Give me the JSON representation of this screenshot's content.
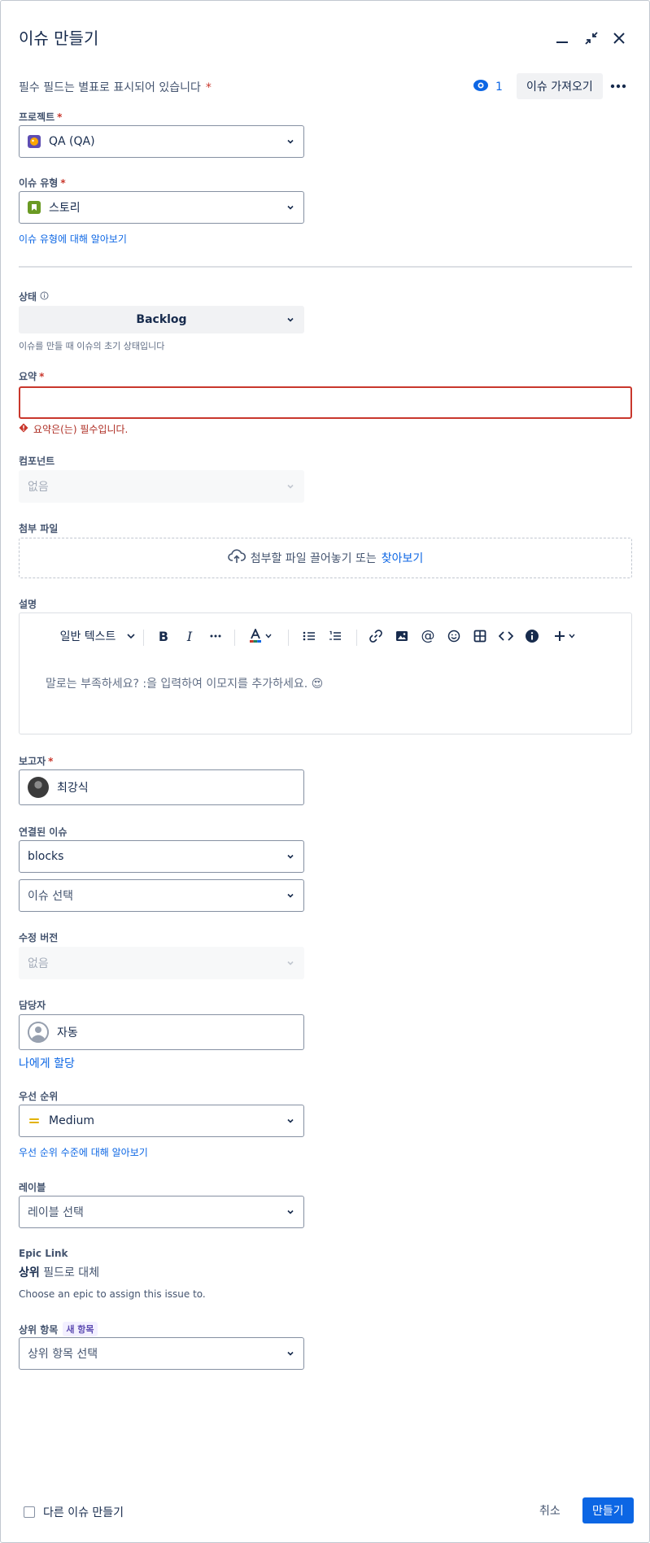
{
  "header": {
    "title": "이슈 만들기",
    "required_note": "필수 필드는 별표로 표시되어 있습니다",
    "required_star": "*",
    "watch_count": "1",
    "import_label": "이슈 가져오기"
  },
  "project": {
    "label": "프로젝트",
    "value": "QA (QA)"
  },
  "issue_type": {
    "label": "이슈 유형",
    "value": "스토리",
    "learn_link": "이슈 유형에 대해 알아보기"
  },
  "status": {
    "label": "상태",
    "value": "Backlog",
    "help": "이슈를 만들 때 이슈의 초기 상태입니다"
  },
  "summary": {
    "label": "요약",
    "value": "",
    "error": "요약은(는) 필수입니다."
  },
  "components": {
    "label": "컴포넌트",
    "value": "없음"
  },
  "attachment": {
    "label": "첨부 파일",
    "drop_text": "첨부할 파일 끌어놓기 또는",
    "browse": "찾아보기"
  },
  "description": {
    "label": "설명",
    "text_style": "일반 텍스트",
    "placeholder": "말로는 부족하세요? :을 입력하여 이모지를 추가하세요. 😍"
  },
  "reporter": {
    "label": "보고자",
    "value": "최강식"
  },
  "linked_issues": {
    "label": "연결된 이슈",
    "link_type": "blocks",
    "issue_placeholder": "이슈 선택"
  },
  "fix_version": {
    "label": "수정 버전",
    "value": "없음"
  },
  "assignee": {
    "label": "담당자",
    "value": "자동",
    "assign_me": "나에게 할당"
  },
  "priority": {
    "label": "우선 순위",
    "value": "Medium",
    "learn_link": "우선 순위 수준에 대해 알아보기"
  },
  "labels": {
    "label": "레이블",
    "placeholder": "레이블 선택"
  },
  "epic_link": {
    "label": "Epic Link",
    "replace_bold": "상위",
    "replace_rest": "필드로 대체",
    "help": "Choose an epic to assign this issue to."
  },
  "parent": {
    "label": "상위 항목",
    "badge": "새 항목",
    "placeholder": "상위 항목 선택"
  },
  "footer": {
    "create_another": "다른 이슈 만들기",
    "cancel": "취소",
    "create": "만들기"
  },
  "colors": {
    "primary": "#0c66e4",
    "danger": "#c9372c",
    "story": "#6a9a23",
    "priority_medium": "#e2b203"
  }
}
